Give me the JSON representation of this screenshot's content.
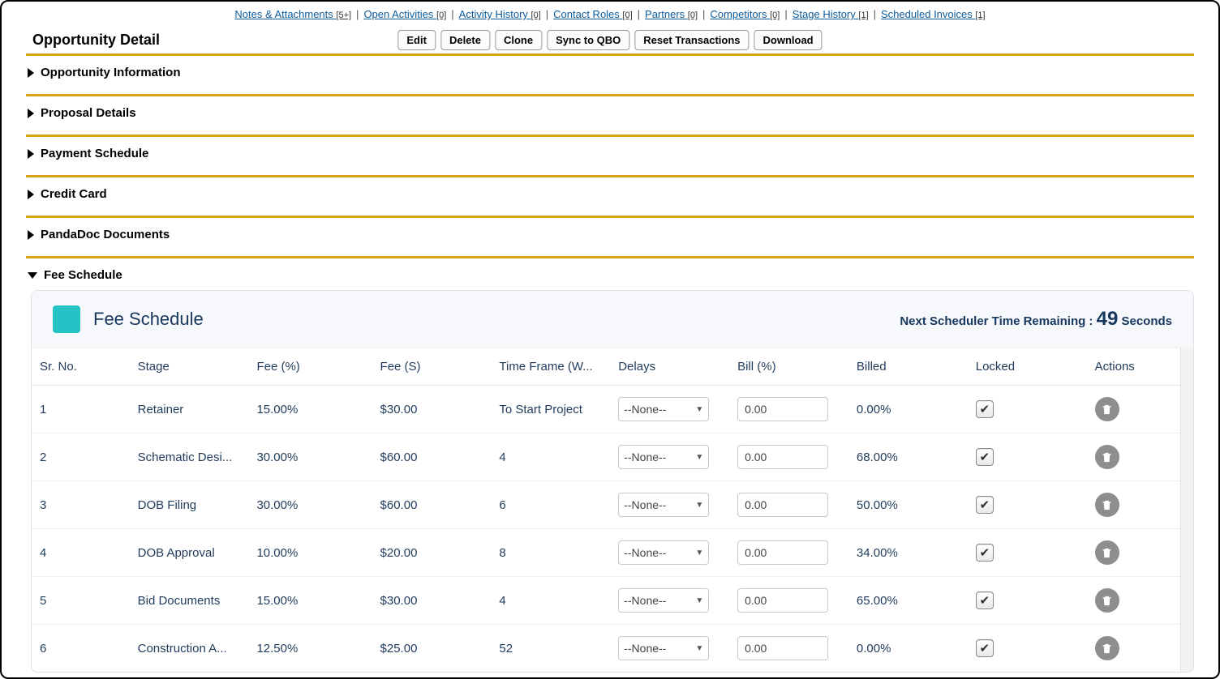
{
  "topLinks": [
    {
      "label": "Notes & Attachments",
      "count": "[5+]"
    },
    {
      "label": "Open Activities",
      "count": "[0]"
    },
    {
      "label": "Activity History",
      "count": "[0]"
    },
    {
      "label": "Contact Roles",
      "count": "[0]"
    },
    {
      "label": "Partners",
      "count": "[0]"
    },
    {
      "label": "Competitors",
      "count": "[0]"
    },
    {
      "label": "Stage History",
      "count": "[1]"
    },
    {
      "label": "Scheduled Invoices",
      "count": "[1]"
    }
  ],
  "pageTitle": "Opportunity Detail",
  "buttons": {
    "edit": "Edit",
    "delete": "Delete",
    "clone": "Clone",
    "sync": "Sync to QBO",
    "reset": "Reset Transactions",
    "download": "Download"
  },
  "sections": {
    "opportunityInfo": "Opportunity Information",
    "proposalDetails": "Proposal Details",
    "paymentSchedule": "Payment Schedule",
    "creditCard": "Credit Card",
    "pandadoc": "PandaDoc Documents",
    "feeSchedule": "Fee Schedule"
  },
  "feeCard": {
    "title": "Fee Schedule",
    "schedulerPrefix": "Next Scheduler Time Remaining : ",
    "schedulerValue": "49",
    "schedulerSuffix": " Seconds"
  },
  "columns": {
    "sr": "Sr. No.",
    "stage": "Stage",
    "feePercent": "Fee (%)",
    "feeAmount": "Fee (S)",
    "timeFrame": "Time Frame (W...",
    "delays": "Delays",
    "billPercent": "Bill (%)",
    "billed": "Billed",
    "locked": "Locked",
    "actions": "Actions"
  },
  "delayDefault": "--None--",
  "rows": [
    {
      "sr": "1",
      "stage": "Retainer",
      "feePercent": "15.00%",
      "feeAmount": "$30.00",
      "timeFrame": "To Start Project",
      "delay": "--None--",
      "bill": "0.00",
      "billed": "0.00%",
      "locked": true
    },
    {
      "sr": "2",
      "stage": "Schematic Desi...",
      "feePercent": "30.00%",
      "feeAmount": "$60.00",
      "timeFrame": "4",
      "delay": "--None--",
      "bill": "0.00",
      "billed": "68.00%",
      "locked": true
    },
    {
      "sr": "3",
      "stage": "DOB Filing",
      "feePercent": "30.00%",
      "feeAmount": "$60.00",
      "timeFrame": "6",
      "delay": "--None--",
      "bill": "0.00",
      "billed": "50.00%",
      "locked": true
    },
    {
      "sr": "4",
      "stage": "DOB Approval",
      "feePercent": "10.00%",
      "feeAmount": "$20.00",
      "timeFrame": "8",
      "delay": "--None--",
      "bill": "0.00",
      "billed": "34.00%",
      "locked": true
    },
    {
      "sr": "5",
      "stage": "Bid Documents",
      "feePercent": "15.00%",
      "feeAmount": "$30.00",
      "timeFrame": "4",
      "delay": "--None--",
      "bill": "0.00",
      "billed": "65.00%",
      "locked": true
    },
    {
      "sr": "6",
      "stage": "Construction A...",
      "feePercent": "12.50%",
      "feeAmount": "$25.00",
      "timeFrame": "52",
      "delay": "--None--",
      "bill": "0.00",
      "billed": "0.00%",
      "locked": true
    }
  ]
}
